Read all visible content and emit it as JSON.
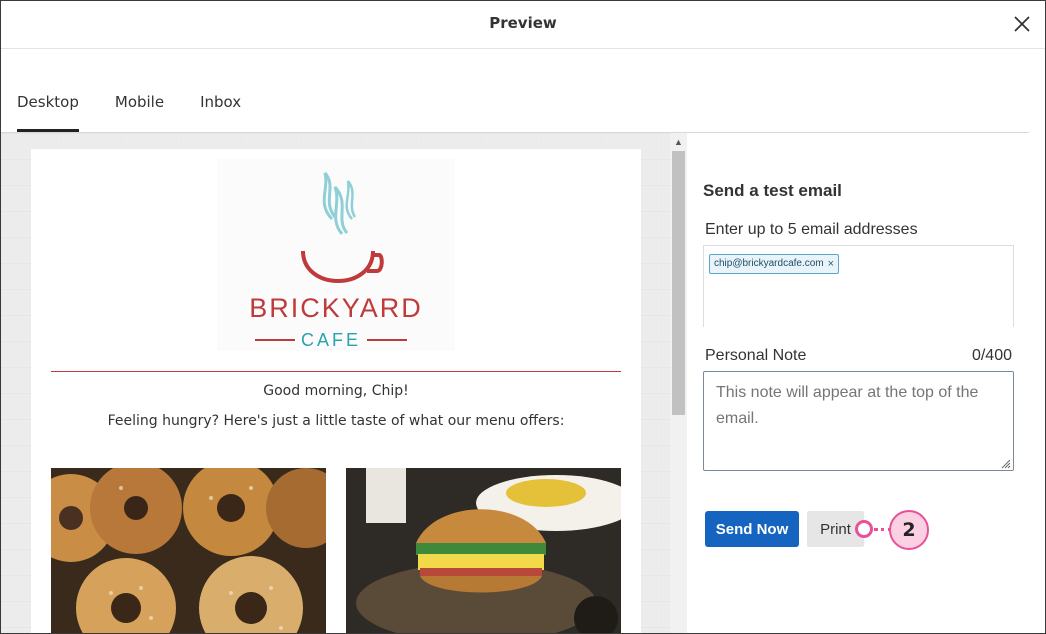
{
  "window": {
    "title": "Preview",
    "close_icon": "close-icon"
  },
  "tabs": [
    {
      "label": "Desktop",
      "active": true
    },
    {
      "label": "Mobile",
      "active": false
    },
    {
      "label": "Inbox",
      "active": false
    }
  ],
  "email_preview": {
    "logo": {
      "name": "BRICKYARD",
      "subname": "CAFE",
      "icon": "coffee-cup-logo"
    },
    "greeting": "Good morning, Chip!",
    "intro": "Feeling hungry? Here's just a little taste of what our menu offers:",
    "images": [
      "bagels-photo",
      "croissant-sandwich-photo"
    ]
  },
  "test_email": {
    "title": "Send a test email",
    "addresses_label": "Enter up to 5 email addresses",
    "addresses": [
      "chip@brickyardcafe.com"
    ],
    "chip_remove": "×",
    "note_label": "Personal Note",
    "note_count": "0/400",
    "note_placeholder": "This note will appear at the top of the email.",
    "send_label": "Send Now",
    "print_label": "Print"
  },
  "callout": {
    "number": "2"
  },
  "colors": {
    "primary_button": "#1464c0",
    "brand_red": "#c0393b",
    "brand_teal": "#2aa3ad",
    "callout_pink": "#e8509a"
  }
}
